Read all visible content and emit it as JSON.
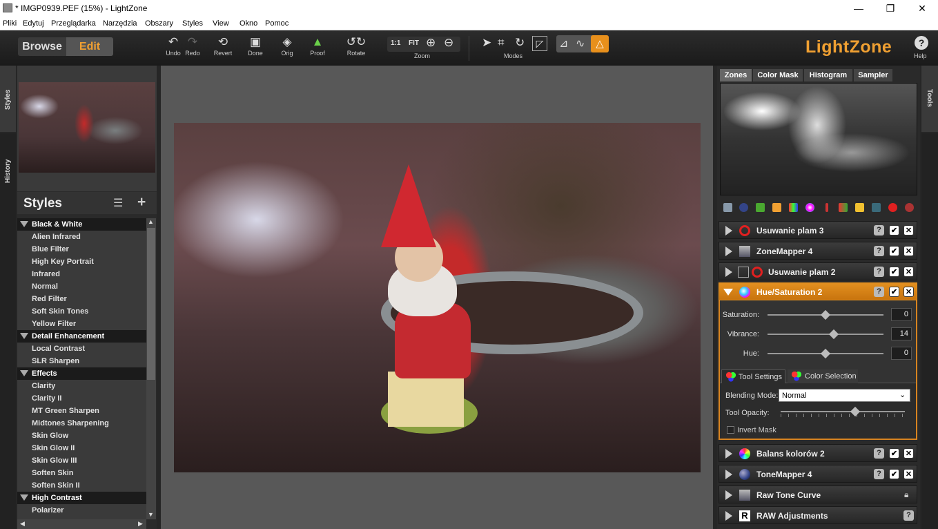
{
  "window": {
    "title": "* IMGP0939.PEF (15%) - LightZone",
    "minimize": "—",
    "maximize": "❐",
    "close": "✕"
  },
  "menu": [
    "Pliki",
    "Edytuj",
    "Przeglądarka",
    "Narzędzia",
    "Obszary",
    "Styles",
    "View",
    "Okno",
    "Pomoc"
  ],
  "toolbar": {
    "browse": "Browse",
    "edit": "Edit",
    "undo": "Undo",
    "redo": "Redo",
    "revert": "Revert",
    "done": "Done",
    "orig": "Orig",
    "proof": "Proof",
    "rotate": "Rotate",
    "zoom_11": "1:1",
    "zoom_fit": "FIT",
    "zoom": "Zoom",
    "modes": "Modes",
    "logo": "LightZone",
    "help": "Help"
  },
  "side_tabs": {
    "styles": "Styles",
    "history": "History",
    "tools": "Tools"
  },
  "styles_panel": {
    "title": "Styles",
    "items": [
      {
        "label": "Black & White",
        "cat": true
      },
      {
        "label": "Alien Infrared"
      },
      {
        "label": "Blue Filter"
      },
      {
        "label": "High Key Portrait"
      },
      {
        "label": "Infrared"
      },
      {
        "label": "Normal"
      },
      {
        "label": "Red Filter"
      },
      {
        "label": "Soft Skin Tones"
      },
      {
        "label": "Yellow Filter"
      },
      {
        "label": "Detail Enhancement",
        "cat": true
      },
      {
        "label": "Local Contrast"
      },
      {
        "label": "SLR Sharpen"
      },
      {
        "label": "Effects",
        "cat": true
      },
      {
        "label": "Clarity"
      },
      {
        "label": "Clarity II"
      },
      {
        "label": "MT Green Sharpen"
      },
      {
        "label": "Midtones Sharpening"
      },
      {
        "label": "Skin Glow"
      },
      {
        "label": "Skin Glow II"
      },
      {
        "label": "Skin Glow III"
      },
      {
        "label": "Soften Skin"
      },
      {
        "label": "Soften Skin II"
      },
      {
        "label": "High Contrast",
        "cat": true
      },
      {
        "label": "Polarizer"
      }
    ]
  },
  "right_tabs": [
    "Zones",
    "Color Mask",
    "Histogram",
    "Sampler"
  ],
  "tools": [
    {
      "label": "Usuwanie plam 3",
      "color": "#e02020",
      "lock": false
    },
    {
      "label": "ZoneMapper 4",
      "color": "#8899aa",
      "lock": false
    },
    {
      "label": "Usuwanie plam 2",
      "color": "#e02020",
      "lock": false
    },
    {
      "label": "Hue/Saturation 2",
      "color": "#40a0ff",
      "active": true
    },
    {
      "label": "Balans kolorów 2",
      "color": "#ff4060",
      "lock": false
    },
    {
      "label": "ToneMapper 4",
      "color": "#334488",
      "lock": false
    },
    {
      "label": "Raw Tone Curve",
      "color": "#8899aa",
      "lock": true
    },
    {
      "label": "RAW Adjustments",
      "color": "#ffffff",
      "raw": true
    }
  ],
  "hue_sat": {
    "saturation_label": "Saturation:",
    "saturation": "0",
    "vibrance_label": "Vibrance:",
    "vibrance": "14",
    "hue_label": "Hue:",
    "hue": "0",
    "tab_tool_settings": "Tool Settings",
    "tab_color_selection": "Color Selection",
    "blending_label": "Blending Mode:",
    "blending": "Normal",
    "opacity_label": "Tool Opacity:",
    "invert_mask": "Invert Mask",
    "saturation_pos": 0.5,
    "vibrance_pos": 0.57,
    "hue_pos": 0.5,
    "opacity_pos": 0.6
  },
  "icons": {
    "q": "?",
    "check": "✔",
    "x": "✕"
  }
}
